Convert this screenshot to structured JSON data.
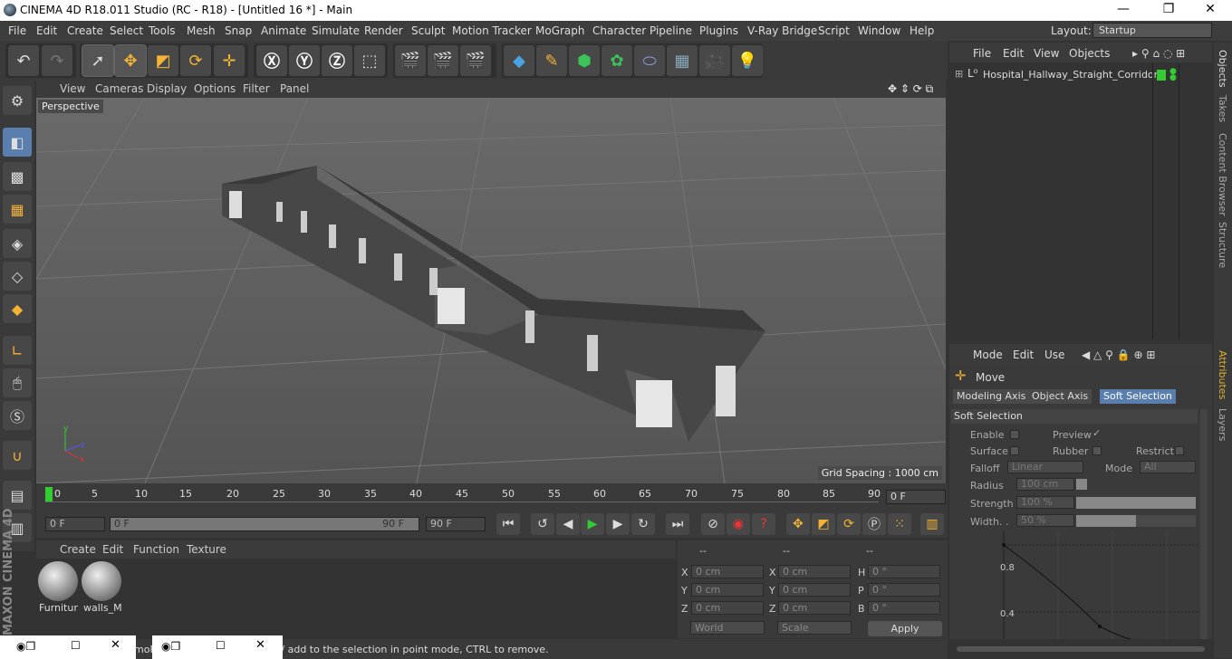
{
  "window": {
    "title": "CINEMA 4D R18.011 Studio (RC - R18) - [Untitled 16 *] - Main"
  },
  "menubar": [
    "File",
    "Edit",
    "Create",
    "Select",
    "Tools",
    "Mesh",
    "Snap",
    "Animate",
    "Simulate",
    "Render",
    "Sculpt",
    "Motion Tracker",
    "MoGraph",
    "Character",
    "Pipeline",
    "Plugins",
    "V-Ray Bridge",
    "Script",
    "Window",
    "Help"
  ],
  "layout": {
    "label": "Layout:",
    "value": "Startup"
  },
  "viewport": {
    "menu": [
      "View",
      "Cameras",
      "Display",
      "Options",
      "Filter",
      "Panel"
    ],
    "label": "Perspective",
    "grid_spacing": "Grid Spacing : 1000 cm"
  },
  "timeline": {
    "ticks": [
      "0",
      "5",
      "10",
      "15",
      "20",
      "25",
      "30",
      "35",
      "40",
      "45",
      "50",
      "55",
      "60",
      "65",
      "70",
      "75",
      "80",
      "85",
      "90"
    ],
    "current_frame": "0 F"
  },
  "transport": {
    "start": "0 F",
    "range_start": "0 F",
    "range_end": "90 F",
    "end": "90 F"
  },
  "material_manager": {
    "menu": [
      "Create",
      "Edit",
      "Function",
      "Texture"
    ],
    "materials": [
      "Furnitur",
      "walls_M"
    ]
  },
  "coordinates": {
    "headers": [
      "--",
      "--",
      "--"
    ],
    "rows": [
      {
        "l1": "X",
        "v1": "0 cm",
        "l2": "X",
        "v2": "0 cm",
        "l3": "H",
        "v3": "0 °"
      },
      {
        "l1": "Y",
        "v1": "0 cm",
        "l2": "Y",
        "v2": "0 cm",
        "l3": "P",
        "v3": "0 °"
      },
      {
        "l1": "Z",
        "v1": "0 cm",
        "l2": "Z",
        "v2": "0 cm",
        "l3": "B",
        "v3": "0 °"
      }
    ],
    "world": "World",
    "scale": "Scale",
    "apply": "Apply"
  },
  "brand": "MAXON CINEMA 4D",
  "status": "FT to quantize movement / add to the selection in point mode, CTRL to remove.",
  "taskbar_partial": "mo",
  "objects": {
    "menu": [
      "File",
      "Edit",
      "View",
      "Objects"
    ],
    "items": [
      "Hospital_Hallway_Straight_Corridor"
    ]
  },
  "side_tabs": [
    "Objects",
    "Takes",
    "Content Browser",
    "Structure",
    "Attributes",
    "Layers"
  ],
  "attributes": {
    "menu": [
      "Mode",
      "Edit",
      "Use"
    ],
    "tool": "Move",
    "tabs": [
      "Modeling Axis",
      "Object Axis",
      "Soft Selection"
    ],
    "section": "Soft Selection",
    "enable": "Enable",
    "preview": "Preview",
    "surface": "Surface",
    "rubber": "Rubber",
    "restrict": "Restrict",
    "falloff_label": "Falloff",
    "falloff": "Linear",
    "mode_label": "Mode",
    "mode": "All",
    "radius_label": "Radius",
    "radius": "100 cm",
    "strength_label": "Strength",
    "strength": "100 %",
    "width_label": "Width. .",
    "width": "50 %",
    "graph_labels": [
      "0.8",
      "0.4"
    ]
  }
}
